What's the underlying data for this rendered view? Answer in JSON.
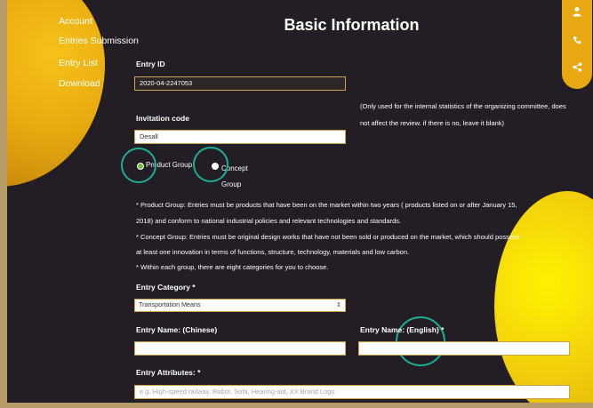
{
  "nav": {
    "account": "Account",
    "entries_submission": "Entries Submission",
    "entry_list": "Entry List",
    "download": "Download"
  },
  "page_title": "Basic Information",
  "social_icons": [
    "user-icon",
    "phone-icon",
    "share-icon"
  ],
  "entry_id": {
    "label": "Entry ID",
    "value": "2020-04-2247053"
  },
  "invitation": {
    "label": "Invitation code",
    "value": "Desall",
    "note": "(Only used for the internal statistics of the organizing committee, does not affect the review. if there is no, leave it blank)"
  },
  "group": {
    "options": [
      {
        "label": "Product Group",
        "selected": true
      },
      {
        "label": "Concept Group",
        "selected": false
      }
    ]
  },
  "descriptions": [
    "* Product Group: Entries must be products that have been on the market within two years ( products listed on or after January 15,",
    "2018) and conform to national industrial policies and relevant technologies and standards.",
    "* Concept Group: Entries must be original design works that have not been sold or produced on the market, which should possess",
    "at least one innovation in terms of functions, structure, technology, materials and low carbon.",
    "* Within each group, there are eight categories for you to choose."
  ],
  "entry_category": {
    "label": "Entry Category *",
    "selected": "Transportation Means"
  },
  "entry_name_cn": {
    "label": "Entry Name: (Chinese)",
    "value": ""
  },
  "entry_name_en": {
    "label": "Entry Name: (English) *",
    "value": ""
  },
  "entry_attributes": {
    "label": "Entry Attributes: *",
    "placeholder": "e.g. High-speed railway, Robot, Sofa, Hearing-aid, XX Brand Logo"
  },
  "colors": {
    "background": "#231d25",
    "accent_gold": "#c9a24c",
    "blob_yellow": "#f5d60b",
    "highlight_teal": "#1fae8f",
    "radio_green": "#6fbf3f"
  }
}
